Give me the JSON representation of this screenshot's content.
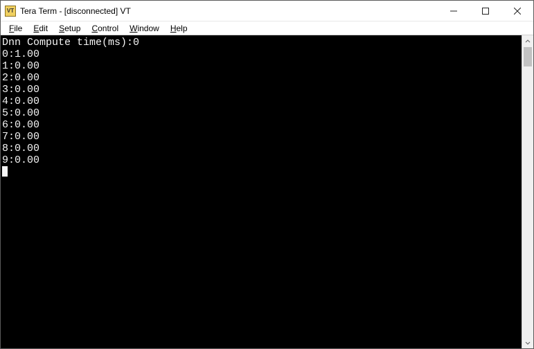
{
  "titlebar": {
    "app_icon_label": "VT",
    "title": "Tera Term - [disconnected] VT"
  },
  "menubar": {
    "items": [
      {
        "label": "File",
        "accel": "F",
        "tail": "ile"
      },
      {
        "label": "Edit",
        "accel": "E",
        "tail": "dit"
      },
      {
        "label": "Setup",
        "accel": "S",
        "tail": "etup"
      },
      {
        "label": "Control",
        "accel": "C",
        "tail": "ontrol"
      },
      {
        "label": "Window",
        "accel": "W",
        "tail": "indow"
      },
      {
        "label": "Help",
        "accel": "H",
        "tail": "elp"
      }
    ]
  },
  "terminal": {
    "lines": [
      "Dnn Compute time(ms):0",
      "0:1.00",
      "1:0.00",
      "2:0.00",
      "3:0.00",
      "4:0.00",
      "5:0.00",
      "6:0.00",
      "7:0.00",
      "8:0.00",
      "9:0.00"
    ]
  }
}
